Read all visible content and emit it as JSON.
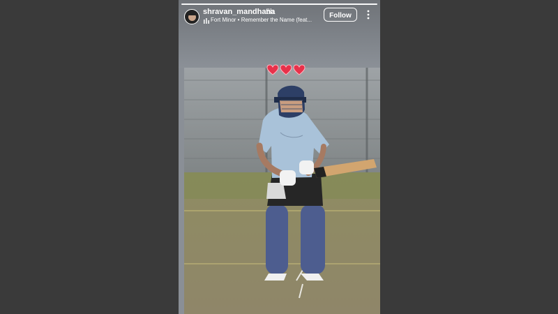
{
  "story": {
    "username": "shravan_mandhana",
    "time_ago": "5h",
    "music": "Fort Minor • Remember the Name (feat...",
    "follow_label": "Follow",
    "sticker": "red-hearts-icon",
    "photo": "cricket-batter-photo"
  },
  "colors": {
    "background": "#3a3a3a",
    "story_background": "#8a8f96",
    "heart": "#e8314a"
  }
}
